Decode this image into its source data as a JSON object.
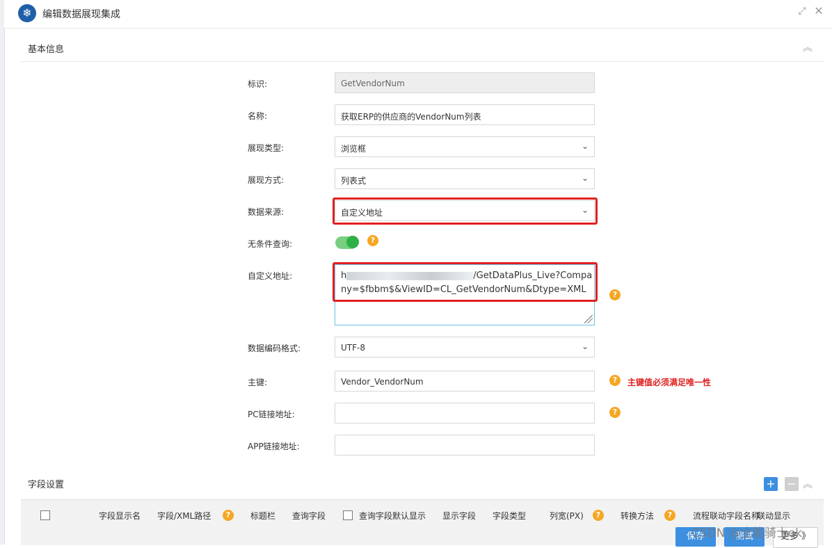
{
  "dialog": {
    "title": "编辑数据展现集成",
    "maximize_icon": "⤢",
    "close_icon": "✕"
  },
  "basic_section": {
    "label": "基本信息",
    "collapse_icon": "︽"
  },
  "form": {
    "id_label": "标识:",
    "id_value": "GetVendorNum",
    "name_label": "名称:",
    "name_value": "获取ERP的供应商的VendorNum列表",
    "display_type_label": "展现类型:",
    "display_type_value": "浏览框",
    "display_mode_label": "展现方式:",
    "display_mode_value": "列表式",
    "data_source_label": "数据来源:",
    "data_source_value": "自定义地址",
    "unconditional_query_label": "无条件查询:",
    "unconditional_query_on": true,
    "custom_url_label": "自定义地址:",
    "custom_url_prefix": "h",
    "custom_url_value": "/GetDataPlus_Live?Company=$fbbm$&ViewID=CL_GetVendorNum&Dtype=XML",
    "encoding_label": "数据编码格式:",
    "encoding_value": "UTF-8",
    "primary_key_label": "主键:",
    "primary_key_value": "Vendor_VendorNum",
    "primary_key_warning": "主键值必须满足唯一性",
    "pc_link_label": "PC链接地址:",
    "pc_link_value": "",
    "app_link_label": "APP链接地址:",
    "app_link_value": "",
    "help_mark": "?"
  },
  "field_section": {
    "label": "字段设置",
    "add_icon": "+",
    "remove_icon": "−",
    "collapse_icon": "︽",
    "columns": [
      "字段显示名",
      "字段/XML路径",
      "标题栏",
      "查询字段",
      "查询字段默认显示",
      "显示字段",
      "字段类型",
      "列宽(PX)",
      "转换方法",
      "流程联动字段名称",
      "联动显示"
    ]
  },
  "buttons": {
    "save": "保存",
    "test": "测试",
    "more": "更多 》"
  },
  "watermark": "CSDN @全能骑士ok",
  "colors": {
    "accent": "#3d8fe0",
    "highlight": "#e02020",
    "help": "#f5a623",
    "toggle_on": "#2db145"
  }
}
